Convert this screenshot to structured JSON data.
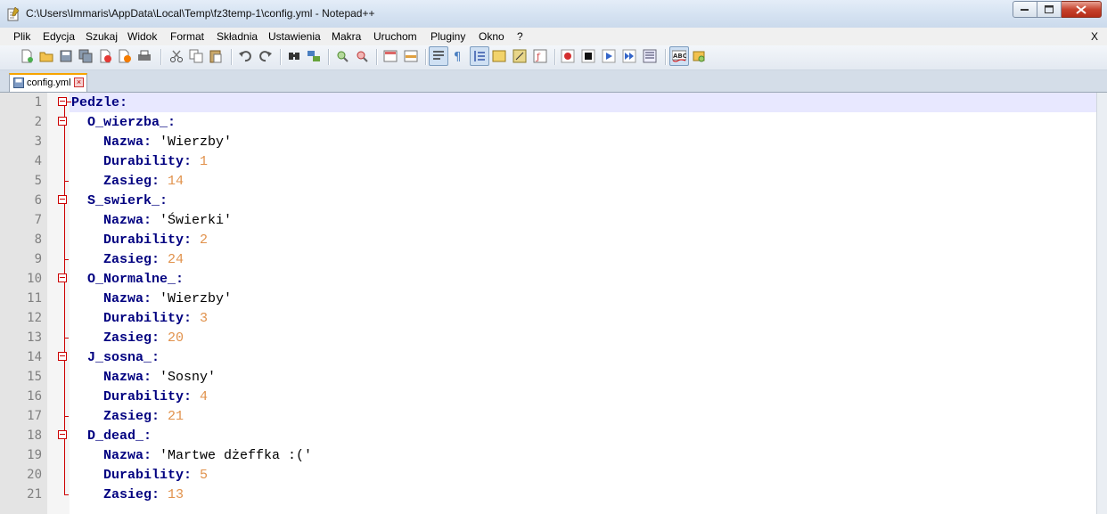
{
  "window": {
    "title": "C:\\Users\\Immaris\\AppData\\Local\\Temp\\fz3temp-1\\config.yml - Notepad++"
  },
  "menu": {
    "items": [
      "Plik",
      "Edycja",
      "Szukaj",
      "Widok",
      "Format",
      "Składnia",
      "Ustawienia",
      "Makra",
      "Uruchom",
      "Pluginy",
      "Okno",
      "?"
    ],
    "close_label": "X"
  },
  "toolbar": {
    "icons": [
      "new-file-icon",
      "open-file-icon",
      "save-icon",
      "save-all-icon",
      "close-icon",
      "close-all-icon",
      "print-icon",
      "cut-icon",
      "copy-icon",
      "paste-icon",
      "undo-icon",
      "redo-icon",
      "find-icon",
      "replace-icon",
      "zoom-in-icon",
      "zoom-out-icon",
      "sync-vertical-icon",
      "sync-horizontal-icon",
      "word-wrap-icon",
      "show-all-chars-icon",
      "indent-guide-icon",
      "user-lang-icon",
      "doc-map-icon",
      "function-list-icon",
      "record-macro-icon",
      "stop-macro-icon",
      "play-macro-icon",
      "run-macro-multiple-icon",
      "save-macro-icon",
      "spell-check-icon",
      "clipboard-history-icon"
    ]
  },
  "tabs": [
    {
      "label": "config.yml",
      "active": true
    }
  ],
  "colors": {
    "key": "#000080",
    "number": "#e1924c",
    "current_line": "#e8e8ff",
    "fold_marker": "#cc0000"
  },
  "editor": {
    "lines": [
      {
        "num": "1",
        "indent": "",
        "key": "Pedzle:",
        "value": "",
        "type": "key",
        "fold": "open-top"
      },
      {
        "num": "2",
        "indent": "  ",
        "key": "O_wierzba_:",
        "value": "",
        "type": "key",
        "fold": "open"
      },
      {
        "num": "3",
        "indent": "    ",
        "key": "Nazwa:",
        "value": " 'Wierzby'",
        "type": "string",
        "fold": "line"
      },
      {
        "num": "4",
        "indent": "    ",
        "key": "Durability:",
        "value": " 1",
        "type": "number",
        "fold": "line"
      },
      {
        "num": "5",
        "indent": "    ",
        "key": "Zasieg:",
        "value": " 14",
        "type": "number",
        "fold": "end"
      },
      {
        "num": "6",
        "indent": "  ",
        "key": "S_swierk_:",
        "value": "",
        "type": "key",
        "fold": "open"
      },
      {
        "num": "7",
        "indent": "    ",
        "key": "Nazwa:",
        "value": " 'Świerki'",
        "type": "string",
        "fold": "line"
      },
      {
        "num": "8",
        "indent": "    ",
        "key": "Durability:",
        "value": " 2",
        "type": "number",
        "fold": "line"
      },
      {
        "num": "9",
        "indent": "    ",
        "key": "Zasieg:",
        "value": " 24",
        "type": "number",
        "fold": "end"
      },
      {
        "num": "10",
        "indent": "  ",
        "key": "O_Normalne_:",
        "value": "",
        "type": "key",
        "fold": "open"
      },
      {
        "num": "11",
        "indent": "    ",
        "key": "Nazwa:",
        "value": " 'Wierzby'",
        "type": "string",
        "fold": "line"
      },
      {
        "num": "12",
        "indent": "    ",
        "key": "Durability:",
        "value": " 3",
        "type": "number",
        "fold": "line"
      },
      {
        "num": "13",
        "indent": "    ",
        "key": "Zasieg:",
        "value": " 20",
        "type": "number",
        "fold": "end"
      },
      {
        "num": "14",
        "indent": "  ",
        "key": "J_sosna_:",
        "value": "",
        "type": "key",
        "fold": "open"
      },
      {
        "num": "15",
        "indent": "    ",
        "key": "Nazwa:",
        "value": " 'Sosny'",
        "type": "string",
        "fold": "line"
      },
      {
        "num": "16",
        "indent": "    ",
        "key": "Durability:",
        "value": " 4",
        "type": "number",
        "fold": "line"
      },
      {
        "num": "17",
        "indent": "    ",
        "key": "Zasieg:",
        "value": " 21",
        "type": "number",
        "fold": "end"
      },
      {
        "num": "18",
        "indent": "  ",
        "key": "D_dead_:",
        "value": "",
        "type": "key",
        "fold": "open"
      },
      {
        "num": "19",
        "indent": "    ",
        "key": "Nazwa:",
        "value": " 'Martwe dżeffka :('",
        "type": "string",
        "fold": "line"
      },
      {
        "num": "20",
        "indent": "    ",
        "key": "Durability:",
        "value": " 5",
        "type": "number",
        "fold": "line"
      },
      {
        "num": "21",
        "indent": "    ",
        "key": "Zasieg:",
        "value": " 13",
        "type": "number",
        "fold": "last"
      }
    ],
    "current_line": 1
  }
}
